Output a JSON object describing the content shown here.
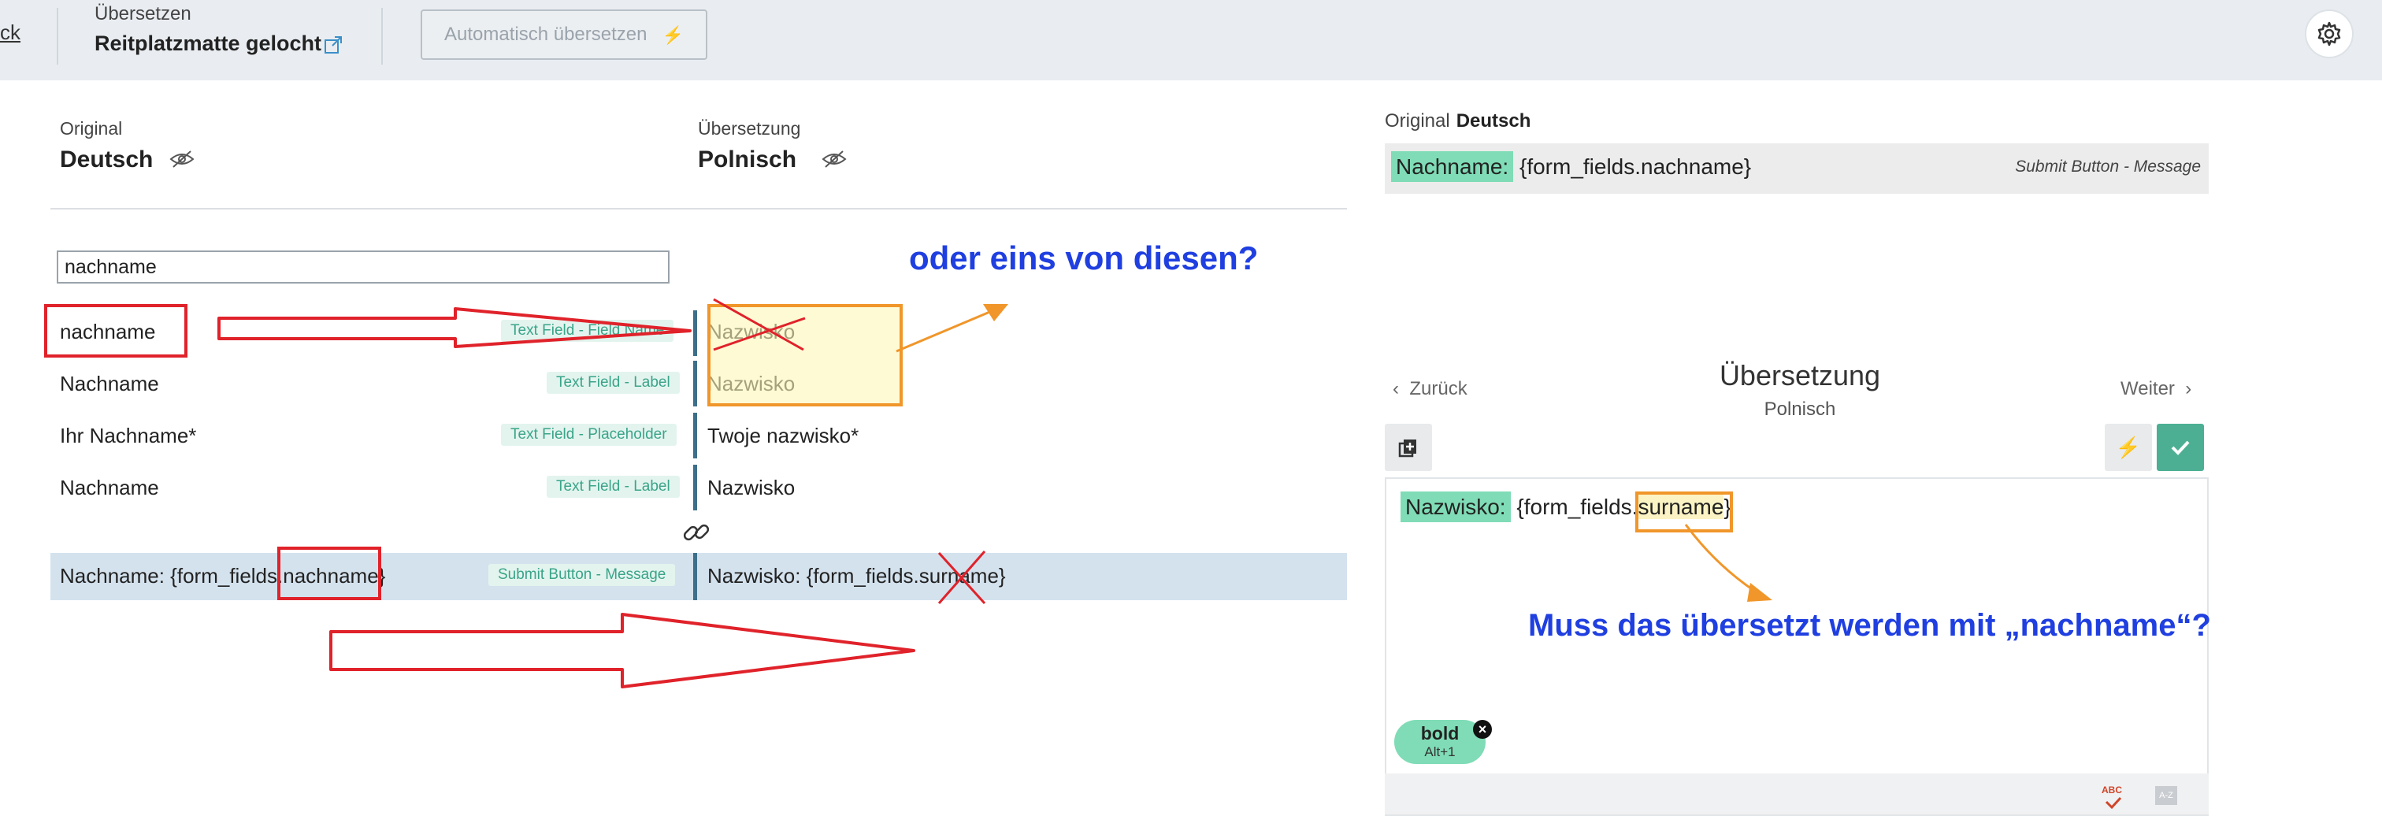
{
  "header": {
    "back_label": "ck",
    "section_label": "Übersetzen",
    "project_title": "Reitplatzmatte gelocht",
    "auto_translate_label": "Automatisch übersetzen"
  },
  "left": {
    "original_label": "Original",
    "original_lang": "Deutsch",
    "translation_label": "Übersetzung",
    "translation_lang": "Polnisch",
    "search_value": "nachname"
  },
  "rows": [
    {
      "source": "nachname",
      "tag": "Text Field - Field Name",
      "target": "Nazwisko"
    },
    {
      "source": "Nachname",
      "tag": "Text Field - Label",
      "target": "Nazwisko"
    },
    {
      "source": "Ihr Nachname*",
      "tag": "Text Field - Placeholder",
      "target": "Twoje nazwisko*"
    },
    {
      "source": "Nachname",
      "tag": "Text Field - Label",
      "target": "Nazwisko"
    },
    {
      "source": "Nachname: {form_fields.nachname}",
      "tag": "Submit Button - Message",
      "target": "Nazwisko: {form_fields.surname}"
    }
  ],
  "right": {
    "original_label": "Original",
    "original_lang": "Deutsch",
    "original_chip": "Nachname:",
    "original_rest": "{form_fields.nachname}",
    "original_meta": "Submit Button - Message",
    "prev_label": "Zurück",
    "next_label": "Weiter",
    "title": "Übersetzung",
    "subtitle": "Polnisch",
    "editor_chip": "Nazwisko:",
    "editor_pre": "{form_fields.",
    "editor_hl": "surname",
    "editor_post": "}",
    "bold_label": "bold",
    "bold_shortcut": "Alt+1",
    "spell_label": "ABC",
    "az_label": "A-Z"
  },
  "annotations": {
    "question1": "oder eins von diesen?",
    "question2": "Muss das übersetzt werden mit „nachname“?"
  },
  "colors": {
    "accent_green": "#7fdcb6",
    "confirm_green": "#4caf93",
    "annotation_red": "#e0222a",
    "annotation_orange": "#f0962a",
    "annotation_blue": "#1f3fe0"
  },
  "icons": [
    "external-link-icon",
    "bolt-icon",
    "gear-icon",
    "eye-off-icon",
    "link-icon",
    "copy-icon",
    "check-icon",
    "chevron-left-icon",
    "chevron-right-icon",
    "close-icon",
    "spellcheck-icon",
    "sort-az-icon"
  ]
}
